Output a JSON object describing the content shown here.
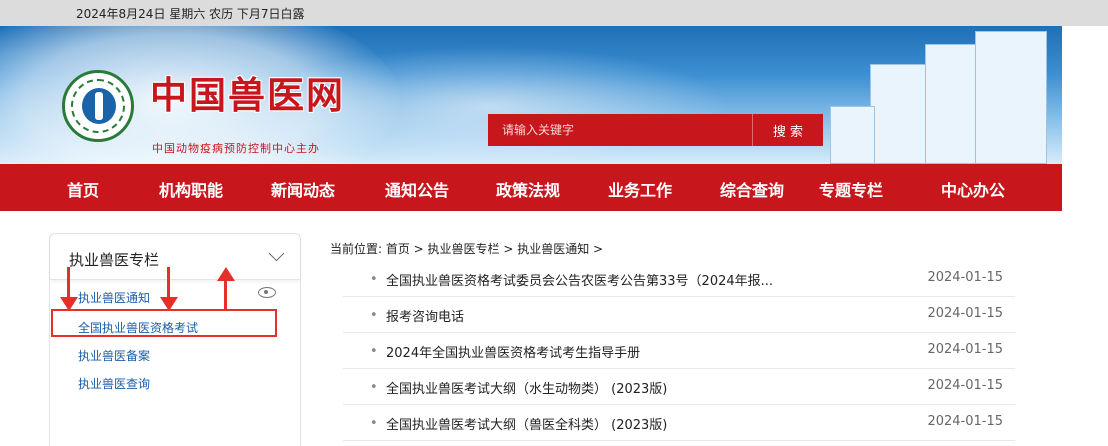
{
  "topbar": {
    "date_text": "2024年8月24日 星期六 农历 下月7日白露"
  },
  "header": {
    "site_title": "中国兽医网",
    "site_subtitle": "中国动物疫病预防控制中心主办",
    "search": {
      "placeholder": "请输入关键字",
      "button_label": "搜 索"
    }
  },
  "nav": {
    "items": [
      "首页",
      "机构职能",
      "新闻动态",
      "通知公告",
      "政策法规",
      "业务工作",
      "综合查询",
      "专题专栏",
      "中心办公"
    ]
  },
  "sidebar": {
    "title": "执业兽医专栏",
    "items": [
      "执业兽医通知",
      "全国执业兽医资格考试",
      "执业兽医备案",
      "执业兽医查询"
    ]
  },
  "breadcrumb": {
    "text": "当前位置: 首页 > 执业兽医专栏 > 执业兽医通知 >"
  },
  "list": {
    "bullet": "•",
    "rows": [
      {
        "title": "全国执业兽医资格考试委员会公告农医考公告第33号（2024年报...",
        "date": "2024-01-15"
      },
      {
        "title": "报考咨询电话",
        "date": "2024-01-15"
      },
      {
        "title": "2024年全国执业兽医资格考试考生指导手册",
        "date": "2024-01-15"
      },
      {
        "title": "全国执业兽医考试大纲（水生动物类） (2023版)",
        "date": "2024-01-15"
      },
      {
        "title": "全国执业兽医考试大纲（兽医全科类） (2023版)",
        "date": "2024-01-15"
      }
    ]
  },
  "colors": {
    "brand_red": "#c8161d",
    "annotation_red": "#e5302a",
    "link_blue": "#1a5ea8"
  }
}
